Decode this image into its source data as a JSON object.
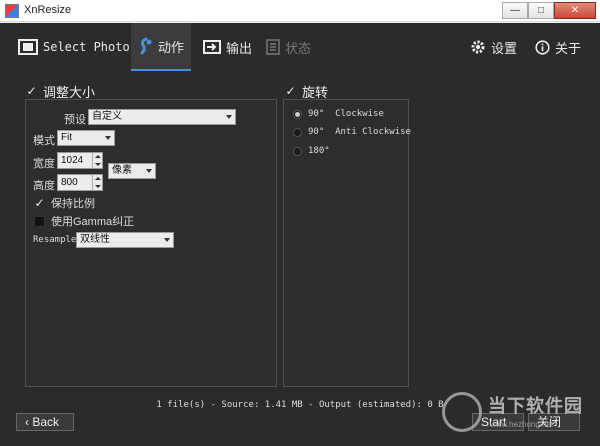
{
  "window": {
    "title": "XnResize",
    "minimize": "—",
    "maximize": "□",
    "close": "✕"
  },
  "toolbar": {
    "select_photos": "Select Photos",
    "action": "动作",
    "output": "输出",
    "status": "状态",
    "settings": "设置",
    "about": "关于"
  },
  "resize": {
    "header": "调整大小",
    "preset_label": "预设",
    "preset_value": "自定义",
    "mode_label": "模式",
    "mode_value": "Fit",
    "width_label": "宽度",
    "width_value": "1024",
    "height_label": "高度",
    "height_value": "800",
    "unit_value": "像素",
    "keep_ratio": "保持比例",
    "gamma": "使用Gamma纠正",
    "resample_label": "Resample",
    "resample_value": "双线性"
  },
  "rotate": {
    "header": "旋转",
    "options": [
      "90°  Clockwise",
      "90°  Anti Clockwise",
      "180°"
    ],
    "selected": 0
  },
  "status_line": "1 file(s) - Source: 1.41 MB - Output (estimated): 0 B",
  "buttons": {
    "back": "Back",
    "start": "Start",
    "close": "关闭"
  },
  "watermark": {
    "text": "当下软件园",
    "url": "www.hezhong.net"
  },
  "colors": {
    "accent": "#4a90d9",
    "background": "#2b2b2b"
  }
}
